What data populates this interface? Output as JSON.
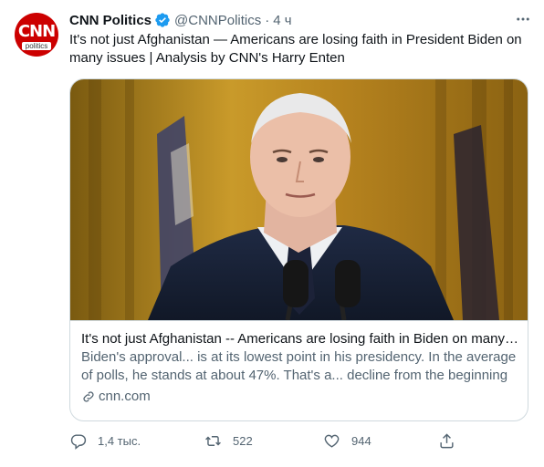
{
  "author": {
    "name": "CNN Politics",
    "handle": "@CNNPolitics",
    "time": "4 ч",
    "avatar_logo": "CNN",
    "avatar_sub": "politics",
    "verified_icon": "verified-badge-icon"
  },
  "tweet": {
    "text": "It's not just Afghanistan — Americans are losing faith in President Biden on many issues | Analysis by CNN's Harry Enten",
    "separator": "·"
  },
  "card": {
    "title": "It's not just Afghanistan -- Americans are losing faith in Biden on many issues",
    "desc_line1": "Biden's approval... is at its lowest point in his presidency. In the average",
    "desc_line2": "of polls, he stands at about 47%. That's a... decline from the beginning",
    "domain": "cnn.com"
  },
  "actions": {
    "reply_count": "1,4 тыс.",
    "retweet_count": "522",
    "like_count": "944"
  },
  "colors": {
    "brand_red": "#cc0000",
    "verified_blue": "#1d9bf0",
    "secondary_text": "#536471",
    "border": "#cfd9de"
  }
}
